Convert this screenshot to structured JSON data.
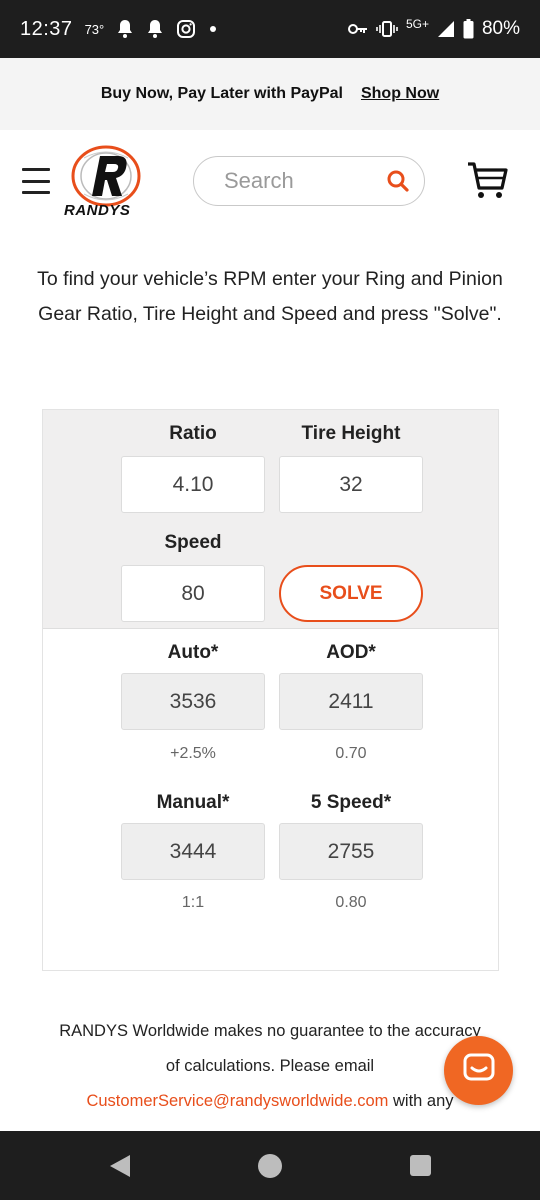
{
  "status_bar": {
    "time": "12:37",
    "temperature": "73°",
    "network": "5G+",
    "battery": "80%",
    "icons": [
      "bell-icon",
      "bell-icon",
      "instagram-icon",
      "dot-icon",
      "key-icon",
      "vibrate-icon",
      "signal-icon",
      "battery-icon"
    ]
  },
  "promo": {
    "text": "Buy Now, Pay Later with PayPal",
    "link": "Shop Now"
  },
  "header": {
    "logo_text": "RANDYS",
    "search_placeholder": "Search"
  },
  "intro": {
    "text": "To find your vehicle’s RPM enter your Ring and Pinion Gear Ratio, Tire Height and Speed and press \"Solve\"."
  },
  "calculator": {
    "ratio": {
      "label": "Ratio",
      "value": "4.10"
    },
    "tire_height": {
      "label": "Tire Height",
      "value": "32"
    },
    "speed": {
      "label": "Speed",
      "value": "80"
    },
    "solve_label": "SOLVE",
    "results": {
      "auto": {
        "label": "Auto*",
        "value": "3536",
        "note": "+2.5%"
      },
      "aod": {
        "label": "AOD*",
        "value": "2411",
        "note": "0.70"
      },
      "manual": {
        "label": "Manual*",
        "value": "3444",
        "note": "1:1"
      },
      "five_speed": {
        "label": "5 Speed*",
        "value": "2755",
        "note": "0.80"
      }
    }
  },
  "disclaimer": {
    "line1": "RANDYS Worldwide makes no guarantee to the accuracy",
    "line2": "of calculations. Please email",
    "email": "CustomerService@randysworldwide.com",
    "tail": " with any"
  },
  "colors": {
    "accent": "#e84e1b",
    "chat": "#f06723",
    "system_bar": "#1e1e1e"
  }
}
